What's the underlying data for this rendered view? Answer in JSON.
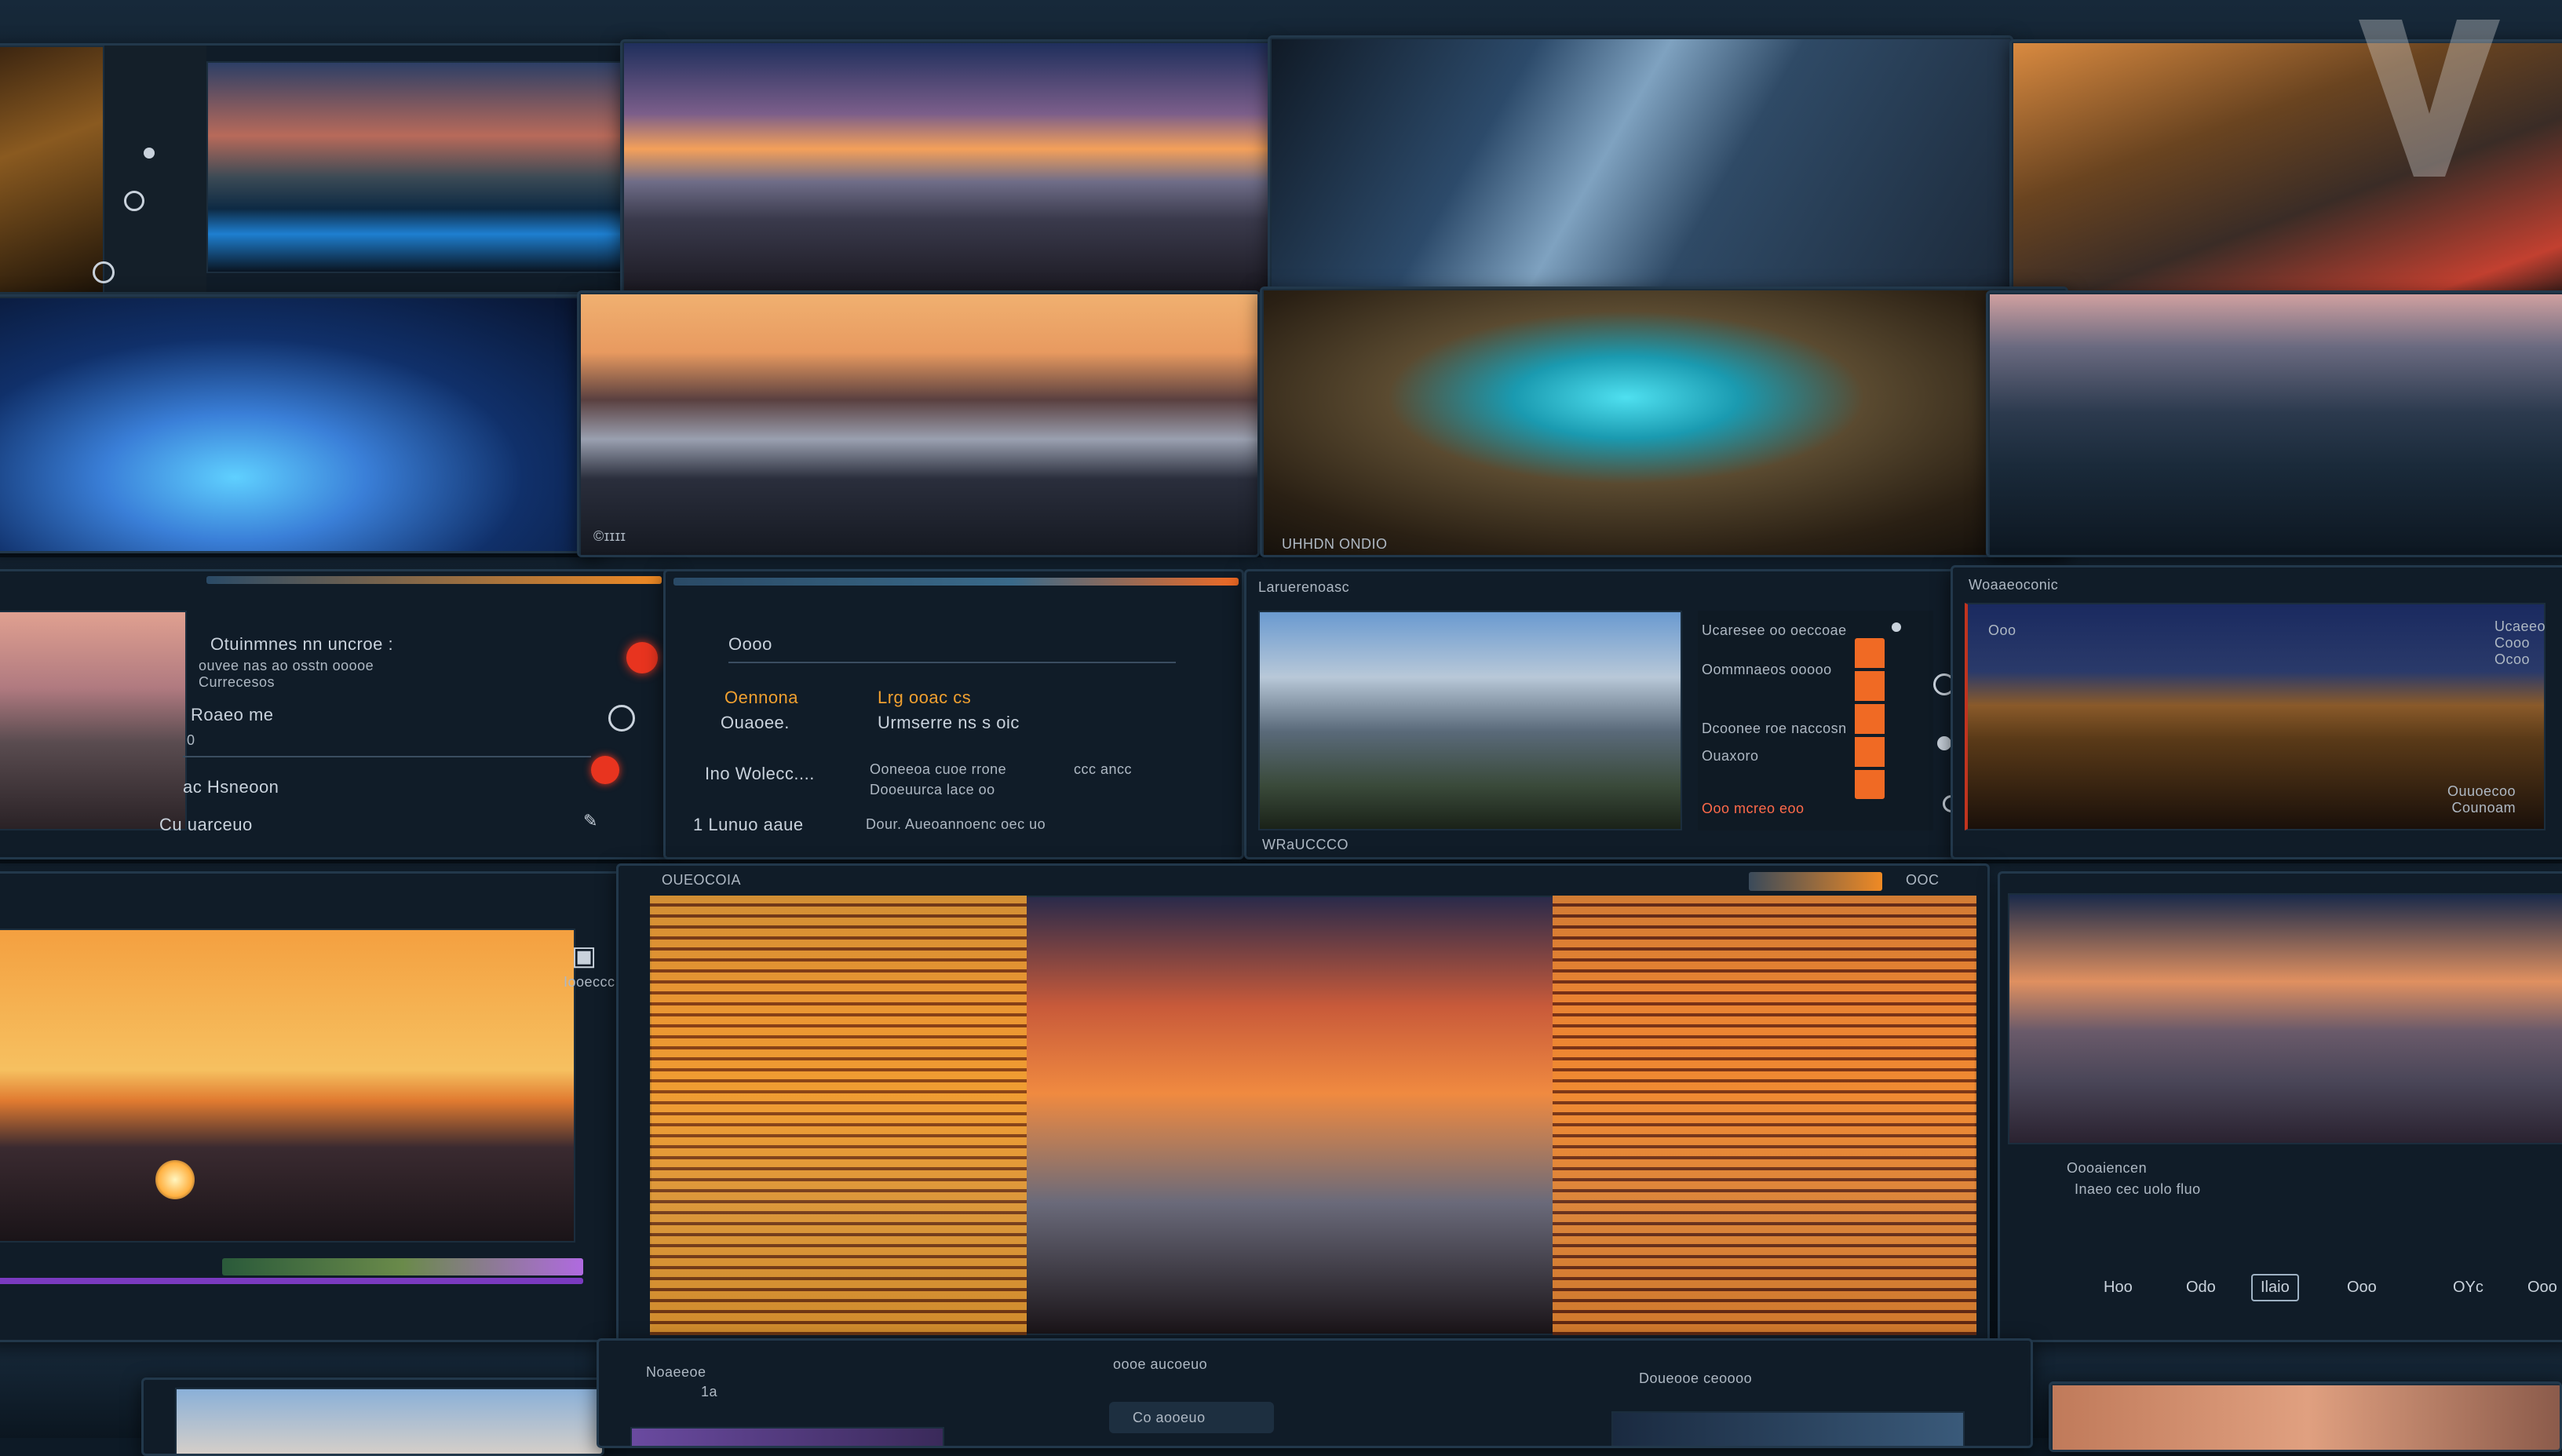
{
  "colors": {
    "accent_orange": "#f08a24",
    "accent_red": "#e8341f",
    "panel_bg": "#101c28",
    "background": "#0d1a26"
  },
  "row2": {
    "stadium_panel": {
      "caption": "UHHDN ONDIO"
    },
    "harbor_panel": {
      "caption": "©ɪɪɪɪ"
    }
  },
  "row3": {
    "panel1": {
      "heading": "Otuinmnes nn uncroe :",
      "subheading": "ouvee nas ao osstn ooooe\nCurrecesos",
      "field_label": "Roaeo me",
      "field_value": "0",
      "footer_label": "Cu uarceuo",
      "section_label": "ac Hsneoon"
    },
    "panel2": {
      "title": "Oooo",
      "orange_label": "Oennona",
      "orange_value": "Lrg ooac cs",
      "row_label": "Ouaoee.",
      "row_value": "Urmserre ns s oic",
      "item_label": "Ino Wolecc....",
      "item_value": "Ooneeoa cuoe rrone",
      "item_value2": "Dooeuurca lace oo",
      "item_extra": "ccc ancc",
      "footer_left": "1 Lunuo aaue",
      "footer_right": "Dour. Aueoannoenc oec uo"
    },
    "panel3": {
      "title": "Laruerenoasc",
      "list": [
        "Ucaresee oo oeccoae",
        "Oommnaeos ooooo",
        "Dcoonee roe naccosn",
        "Ouaxoro",
        "Ooo mcreo eoo"
      ],
      "caption": "WRaUCCCO"
    },
    "panel4": {
      "title": "Woaaeoconic",
      "tag": "Ooo",
      "right_text": "Ucaeeo\nCooo\nOcoo",
      "caption": "Ouuoecoo\nCounoam"
    }
  },
  "row4": {
    "left_panel": {
      "icon_caption": "Iooeccc"
    },
    "center_panel": {
      "title": "OUEOCOIA",
      "tag": "OOC"
    },
    "right_panel": {
      "caption_line1": "Oooaiencen",
      "caption_line2": "Inaeo cec uolo fluo",
      "tabs": [
        "Hoo",
        "Odo",
        "Ilaio",
        "Ooo",
        "OYc",
        "Ooo"
      ],
      "active_tab": "Ilaio"
    }
  },
  "row5": {
    "labels": [
      "Noaeeoe",
      "oooe aucoeuo",
      "Doueooe ceoooo"
    ],
    "sub_label": "1a",
    "chip_label": "Co aooeuo"
  },
  "watermark": {
    "icon": "v-logo-icon"
  }
}
